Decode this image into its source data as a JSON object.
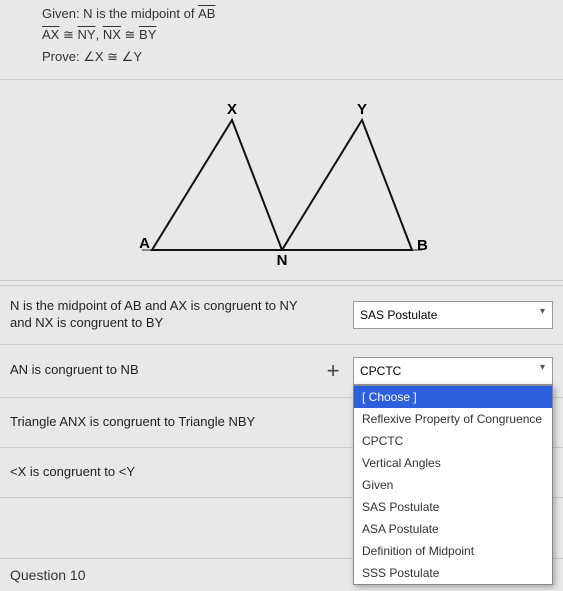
{
  "header": {
    "given_prefix": "Given: N is the midpoint of ",
    "given_seg": "AB",
    "cong_line": {
      "s1": "AX",
      "s2": "NY",
      "s3": "NX",
      "s4": "BY",
      "sym": "≅",
      "sep": ","
    },
    "prove_prefix": "Prove: ",
    "prove_a": "∠X",
    "prove_sym": "≅",
    "prove_b": "∠Y"
  },
  "labels": {
    "X": "X",
    "Y": "Y",
    "A": "A",
    "N": "N",
    "B": "B"
  },
  "rows": [
    {
      "statement": "N is the midpoint of AB and AX is congruent to NY and NX is congruent to BY",
      "plus": "",
      "reason": "SAS Postulate"
    },
    {
      "statement": "AN is congruent to NB",
      "plus": "+",
      "reason": "CPCTC"
    },
    {
      "statement": "Triangle ANX is congruent to Triangle NBY",
      "plus": "",
      "reason": ""
    },
    {
      "statement": "<X is congruent to <Y",
      "plus": "",
      "reason": ""
    }
  ],
  "dropdown_options": [
    "[ Choose ]",
    "Reflexive Property of Congruence",
    "CPCTC",
    "Vertical Angles",
    "Given",
    "SAS Postulate",
    "ASA Postulate",
    "Definition of Midpoint",
    "SSS Postulate"
  ],
  "footer": "Question 10"
}
